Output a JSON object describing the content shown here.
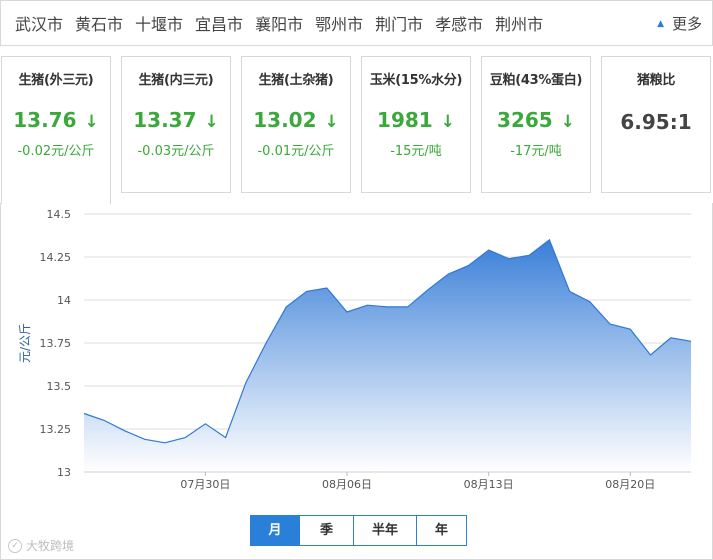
{
  "cities": [
    "武汉市",
    "黄石市",
    "十堰市",
    "宜昌市",
    "襄阳市",
    "鄂州市",
    "荆门市",
    "孝感市",
    "荆州市"
  ],
  "more_label": "更多",
  "cards": [
    {
      "title": "生猪(外三元)",
      "price": "13.76",
      "change": "-0.02元/公斤",
      "trend": "down"
    },
    {
      "title": "生猪(内三元)",
      "price": "13.37",
      "change": "-0.03元/公斤",
      "trend": "down"
    },
    {
      "title": "生猪(土杂猪)",
      "price": "13.02",
      "change": "-0.01元/公斤",
      "trend": "down"
    },
    {
      "title": "玉米(15%水分)",
      "price": "1981",
      "change": "-15元/吨",
      "trend": "down"
    },
    {
      "title": "豆粕(43%蛋白)",
      "price": "3265",
      "change": "-17元/吨",
      "trend": "down"
    },
    {
      "title": "猪粮比",
      "price": "6.95:1",
      "change": "",
      "trend": "none"
    }
  ],
  "range_tabs": [
    "月",
    "季",
    "半年",
    "年"
  ],
  "active_range": "月",
  "watermark": "大牧跨境",
  "colors": {
    "accent": "#2a7fd8",
    "down": "#3aa83a",
    "area_top": "#2f78d6",
    "area_bottom": "#ffffff"
  },
  "chart_data": {
    "type": "area",
    "ylabel": "元/公斤",
    "ylim": [
      13,
      14.5
    ],
    "yticks": [
      13,
      13.25,
      13.5,
      13.75,
      14,
      14.25,
      14.5
    ],
    "xlim": [
      "2018-07-24",
      "2018-08-23"
    ],
    "xtick_labels": [
      {
        "date": "2018-07-30",
        "label": "07月30日"
      },
      {
        "date": "2018-08-06",
        "label": "08月06日"
      },
      {
        "date": "2018-08-13",
        "label": "08月13日"
      },
      {
        "date": "2018-08-20",
        "label": "08月20日"
      }
    ],
    "grid": true,
    "series": [
      {
        "x": [
          "2018-07-24",
          "2018-07-25",
          "2018-07-26",
          "2018-07-27",
          "2018-07-28",
          "2018-07-29",
          "2018-07-30",
          "2018-07-31",
          "2018-08-01",
          "2018-08-02",
          "2018-08-03",
          "2018-08-04",
          "2018-08-05",
          "2018-08-06",
          "2018-08-07",
          "2018-08-08",
          "2018-08-09",
          "2018-08-10",
          "2018-08-11",
          "2018-08-12",
          "2018-08-13",
          "2018-08-14",
          "2018-08-15",
          "2018-08-16",
          "2018-08-17",
          "2018-08-18",
          "2018-08-19",
          "2018-08-20",
          "2018-08-21",
          "2018-08-22",
          "2018-08-23"
        ],
        "values": [
          13.34,
          13.3,
          13.24,
          13.19,
          13.17,
          13.2,
          13.28,
          13.2,
          13.52,
          13.75,
          13.96,
          14.05,
          14.07,
          13.93,
          13.97,
          13.96,
          13.96,
          14.06,
          14.15,
          14.2,
          14.29,
          14.24,
          14.26,
          14.35,
          14.05,
          13.99,
          13.86,
          13.83,
          13.68,
          13.78,
          13.76
        ]
      }
    ]
  }
}
